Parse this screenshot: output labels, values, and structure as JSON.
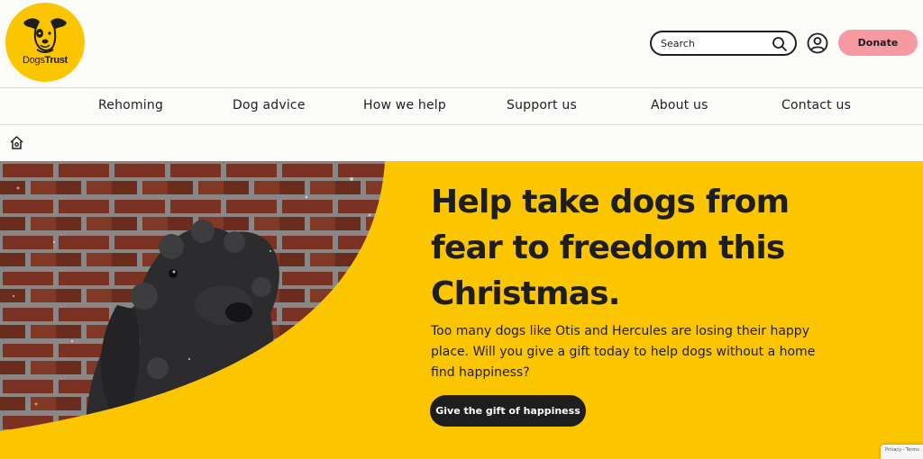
{
  "header": {
    "logo": {
      "icon": "dog-face-icon",
      "text_regular": "Dogs",
      "text_bold": "Trust"
    },
    "search": {
      "placeholder": "Search",
      "icon": "search-icon"
    },
    "account_icon": "user-circle-icon",
    "donate_label": "Donate"
  },
  "nav": {
    "items": [
      {
        "label": "Rehoming"
      },
      {
        "label": "Dog advice"
      },
      {
        "label": "How we help"
      },
      {
        "label": "Support us"
      },
      {
        "label": "About us"
      },
      {
        "label": "Contact us"
      }
    ]
  },
  "breadcrumb": {
    "home_icon": "home-icon"
  },
  "hero": {
    "title": "Help take dogs from fear to freedom this Christmas.",
    "body": "Too many dogs like Otis and Hercules are losing their happy place. Will you give a gift today to help dogs without a home find happiness?",
    "cta_label": "Give the gift of happiness"
  },
  "recaptcha": {
    "text": "Privacy - Terms"
  },
  "colors": {
    "brand_yellow": "#fbc500",
    "donate_pink": "#f59aa1",
    "text_dark": "#1e1e1e",
    "background": "#fbfcfa"
  }
}
